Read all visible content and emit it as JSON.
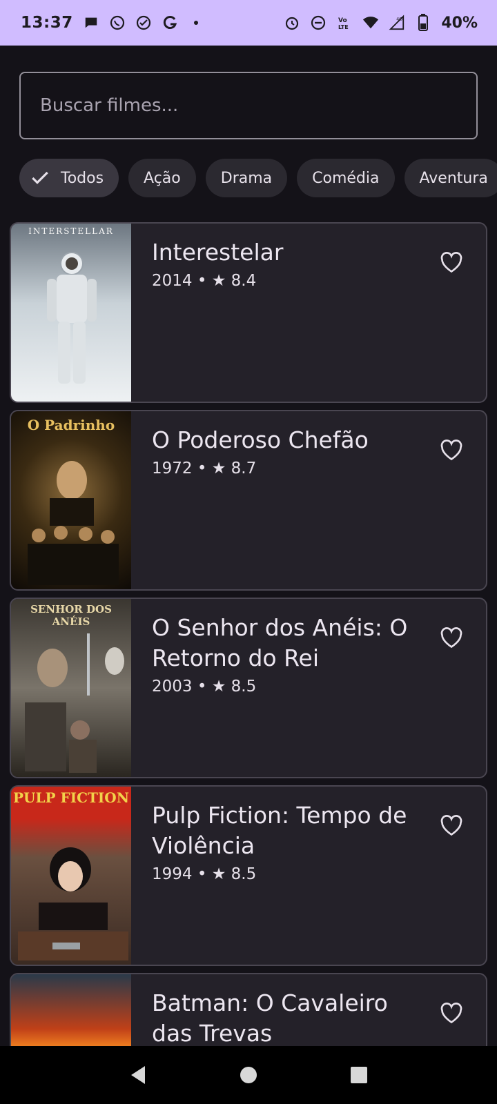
{
  "status_bar": {
    "time": "13:37",
    "battery": "40%",
    "icons_left": [
      "chat-bubble-icon",
      "whatsapp-icon",
      "check-circle-icon",
      "g-icon",
      "dot-icon"
    ],
    "icons_right": [
      "alarm-icon",
      "dnd-icon",
      "volte-icon",
      "wifi-icon",
      "signal-icon",
      "battery-icon"
    ]
  },
  "search": {
    "placeholder": "Buscar filmes..."
  },
  "chips": [
    {
      "label": "Todos",
      "selected": true
    },
    {
      "label": "Ação",
      "selected": false
    },
    {
      "label": "Drama",
      "selected": false
    },
    {
      "label": "Comédia",
      "selected": false
    },
    {
      "label": "Aventura",
      "selected": false
    }
  ],
  "movies": [
    {
      "title": "Interestelar",
      "meta": "2014 • ★ 8.4",
      "poster_text": "INTERSTELLAR",
      "poster_color": "#9aa6b0"
    },
    {
      "title": "O Poderoso Chefão",
      "meta": "1972 • ★ 8.7",
      "poster_text": "O Padrinho",
      "poster_color": "#3a2a12"
    },
    {
      "title": "O Senhor dos Anéis: O Retorno do Rei",
      "meta": "2003 • ★ 8.5",
      "poster_text": "SENHOR DOS ANÉIS",
      "poster_color": "#5a5650"
    },
    {
      "title": "Pulp Fiction: Tempo de Violência",
      "meta": "1994 • ★ 8.5",
      "poster_text": "PULP FICTION",
      "poster_color": "#7a2a18"
    },
    {
      "title": "Batman: O Cavaleiro das Trevas",
      "meta": "",
      "poster_text": "",
      "poster_color": "#2a3a4a"
    }
  ],
  "colors": {
    "accent": "#d0bcff",
    "background": "#141218",
    "card": "#242129"
  }
}
